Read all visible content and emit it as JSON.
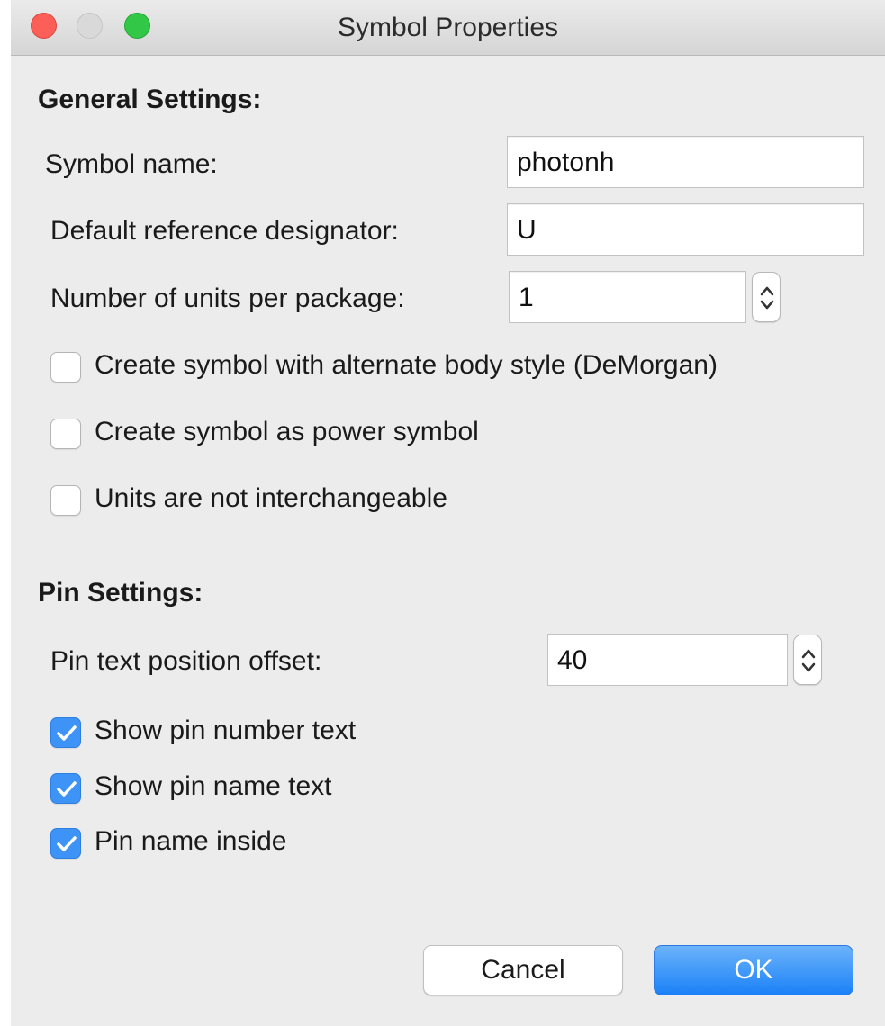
{
  "window": {
    "title": "Symbol Properties"
  },
  "general": {
    "heading": "General Settings:",
    "symbol_name_label": "Symbol name:",
    "symbol_name_value": "photonh",
    "ref_designator_label": "Default reference designator:",
    "ref_designator_value": "U",
    "units_label": "Number of units per package:",
    "units_value": "1",
    "checkboxes": [
      {
        "label": "Create symbol with alternate body style (DeMorgan)",
        "checked": false
      },
      {
        "label": "Create symbol as power symbol",
        "checked": false
      },
      {
        "label": "Units are not interchangeable",
        "checked": false
      }
    ]
  },
  "pins": {
    "heading": "Pin Settings:",
    "offset_label": "Pin text position offset:",
    "offset_value": "40",
    "checkboxes": [
      {
        "label": "Show pin number text",
        "checked": true
      },
      {
        "label": "Show pin name text",
        "checked": true
      },
      {
        "label": "Pin name inside",
        "checked": true
      }
    ]
  },
  "buttons": {
    "cancel": "Cancel",
    "ok": "OK"
  },
  "colors": {
    "accent": "#3d94f6",
    "window_bg": "#ececec",
    "close": "#fc5f57",
    "maximize": "#33c748"
  }
}
